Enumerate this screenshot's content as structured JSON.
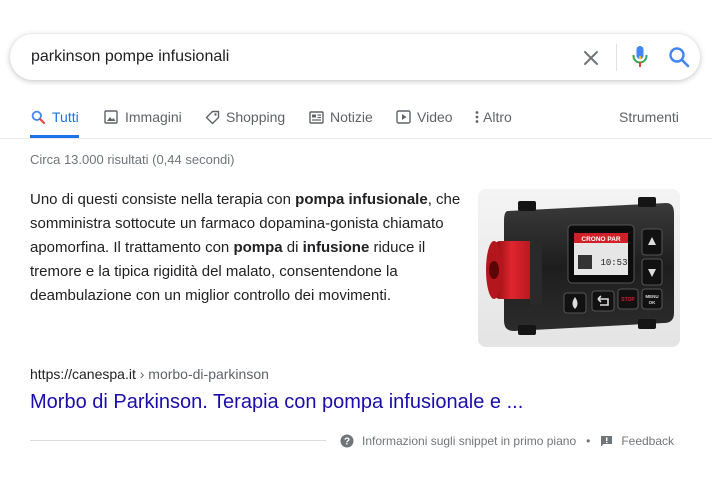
{
  "search": {
    "query": "parkinson pompe infusionali",
    "icons": {
      "clear": "close-icon",
      "voice": "microphone-icon",
      "submit": "search-icon"
    },
    "colors": {
      "mic_blue": "#4285f4",
      "mic_red": "#ea4335",
      "search_blue": "#4285f4"
    }
  },
  "tabs": {
    "items": [
      {
        "label": "Tutti",
        "icon": "search-icon",
        "active": true
      },
      {
        "label": "Immagini",
        "icon": "image-icon"
      },
      {
        "label": "Shopping",
        "icon": "tag-icon"
      },
      {
        "label": "Notizie",
        "icon": "news-icon"
      },
      {
        "label": "Video",
        "icon": "play-icon"
      },
      {
        "label": "Altro",
        "icon": "more-vert-icon"
      }
    ],
    "tools_label": "Strumenti",
    "active_color": "#1a73e8"
  },
  "stats": "Circa 13.000 risultati (0,44 secondi)",
  "snippet": {
    "t1": "Uno di questi consiste nella terapia con ",
    "b1": "pompa infusionale",
    "t2": ", che somministra sottocute un farmaco dopamina-gonista chiamato apomorfina. Il trattamento con ",
    "b2": "pompa",
    "t3": " di ",
    "b3": "infusione",
    "t4": " riduce il tremore e la tipica rigidità del malato, consentendone la deambulazione con un miglior controllo dei movimenti.",
    "image": {
      "screen_text": "CRONO PAR",
      "screen_time": "10:53",
      "menu_label": "MENU\nOK",
      "stop_label": "STOP"
    }
  },
  "result": {
    "domain": "https://canespa.it",
    "path": " › morbo-di-parkinson",
    "title": "Morbo di Parkinson. Terapia con pompa infusionale e ...",
    "title_color": "#1a0dab"
  },
  "footer": {
    "info_label": "Informazioni sugli snippet in primo piano",
    "separator": "•",
    "feedback_label": "Feedback"
  }
}
